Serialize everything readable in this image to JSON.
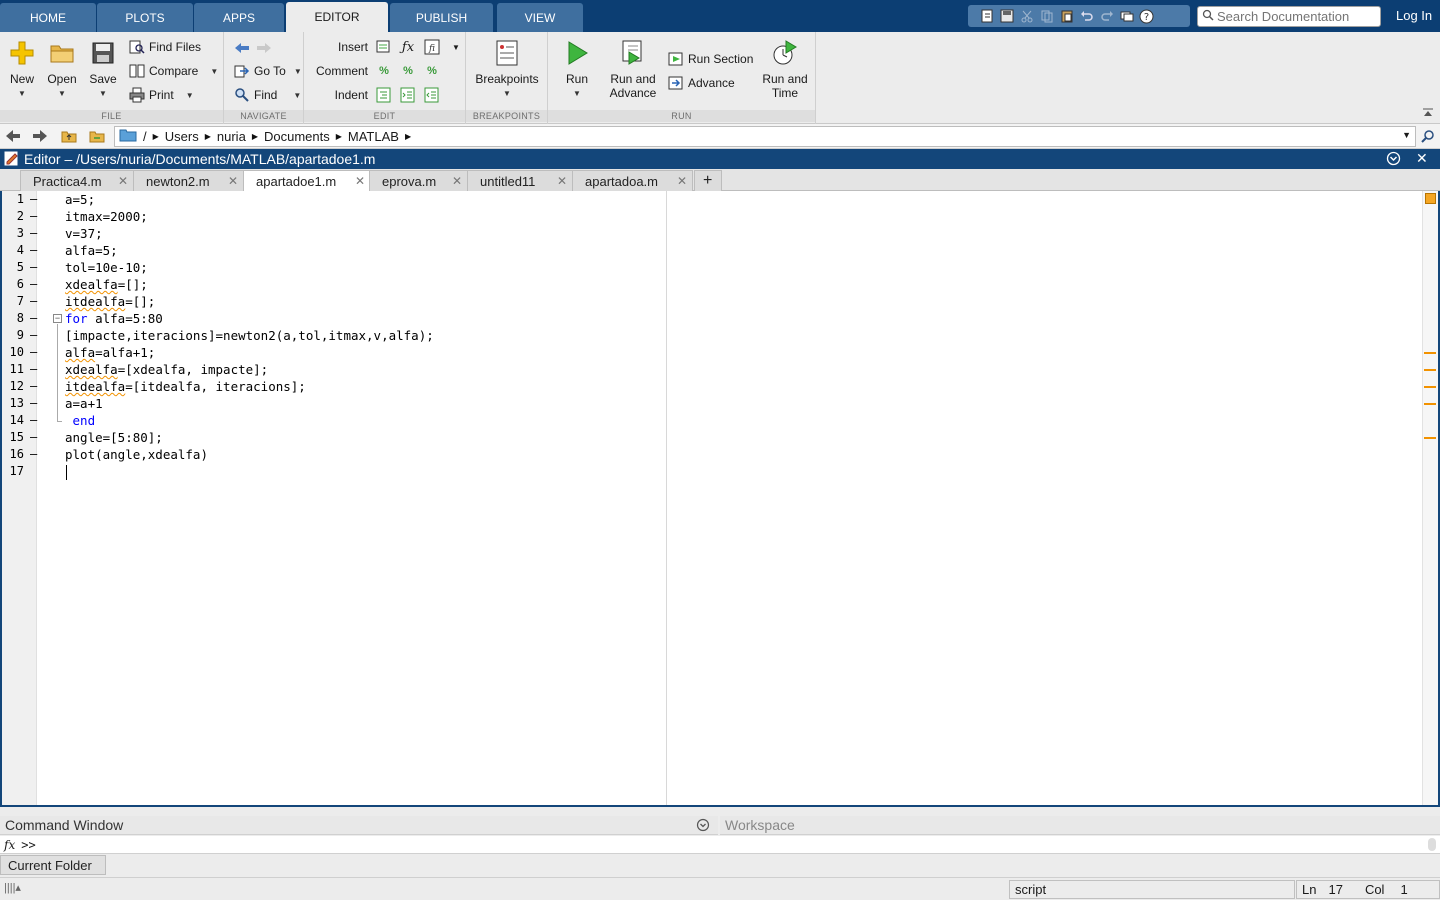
{
  "tabs": [
    {
      "label": "HOME"
    },
    {
      "label": "PLOTS"
    },
    {
      "label": "APPS"
    },
    {
      "label": "EDITOR"
    },
    {
      "label": "PUBLISH"
    },
    {
      "label": "VIEW"
    }
  ],
  "search": {
    "placeholder": "Search Documentation"
  },
  "login_label": "Log In",
  "ribbon": {
    "file": {
      "label": "FILE",
      "new": "New",
      "open": "Open",
      "save": "Save",
      "find_files": "Find Files",
      "compare": "Compare",
      "print": "Print"
    },
    "navigate": {
      "label": "NAVIGATE",
      "goto": "Go To",
      "find": "Find"
    },
    "edit": {
      "label": "EDIT",
      "insert": "Insert",
      "comment": "Comment",
      "indent": "Indent"
    },
    "breakpoints": {
      "label": "BREAKPOINTS",
      "button": "Breakpoints"
    },
    "run": {
      "label": "RUN",
      "run": "Run",
      "run_and_advance_1": "Run and",
      "run_and_advance_2": "Advance",
      "run_section": "Run Section",
      "advance": "Advance",
      "run_and_time_1": "Run and",
      "run_and_time_2": "Time"
    }
  },
  "address": {
    "root": "/",
    "crumbs": [
      "Users",
      "nuria",
      "Documents",
      "MATLAB"
    ]
  },
  "editor": {
    "title": "Editor – /Users/nuria/Documents/MATLAB/apartadoe1.m",
    "files": [
      "Practica4.m",
      "newton2.m",
      "apartadoe1.m",
      "eprova.m",
      "untitled11",
      "apartadoa.m"
    ],
    "active_file": "apartadoe1.m",
    "lines": [
      "a=5;",
      "itmax=2000;",
      "v=37;",
      "alfa=5;",
      "tol=10e-10;",
      "xdealfa=[];",
      "itdealfa=[];",
      "for alfa=5:80",
      "[impacte,iteracions]=newton2(a,tol,itmax,v,alfa);",
      "alfa=alfa+1;",
      "xdealfa=[xdealfa, impacte];",
      "itdealfa=[itdealfa, iteracions];",
      "a=a+1",
      " end",
      "angle=[5:80];",
      "plot(angle,xdealfa)",
      ""
    ],
    "line_numbers": [
      "1",
      "2",
      "3",
      "4",
      "5",
      "6",
      "7",
      "8",
      "9",
      "10",
      "11",
      "12",
      "13",
      "14",
      "15",
      "16",
      "17"
    ]
  },
  "bottom": {
    "command_window": "Command Window",
    "workspace": "Workspace",
    "prompt": ">>",
    "fx": "fx",
    "current_folder": "Current Folder"
  },
  "status": {
    "mode": "script",
    "ln_label": "Ln",
    "ln": "17",
    "col_label": "Col",
    "col": "1"
  },
  "colors": {
    "title_bar": "#13467a",
    "tab_bar": "#0c3e73",
    "keyword": "#0000ff",
    "warning": "#f29200"
  }
}
